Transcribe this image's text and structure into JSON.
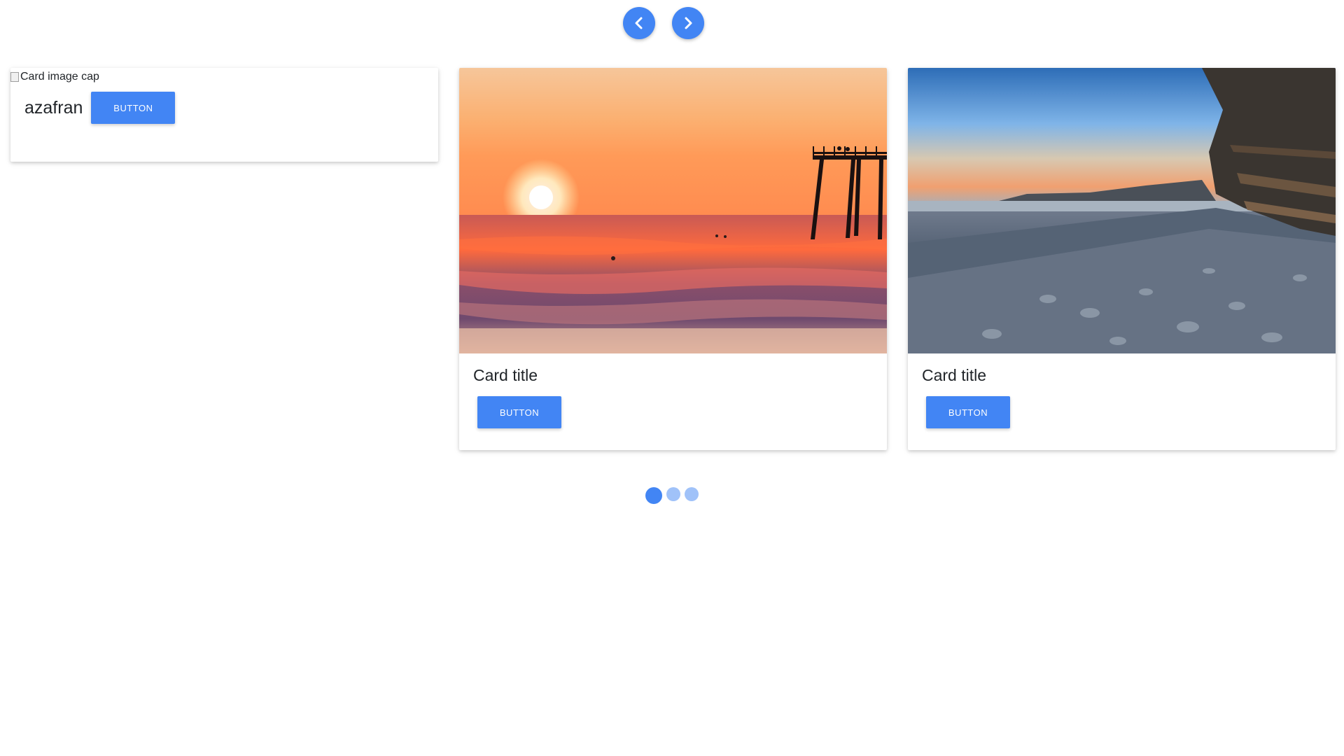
{
  "controls": {
    "prev_icon": "chevron-left-icon",
    "next_icon": "chevron-right-icon"
  },
  "cards": [
    {
      "image_alt": "Card image cap",
      "title": "azafran",
      "button_label": "Button"
    },
    {
      "title": "Card title",
      "button_label": "Button",
      "image": "sunset over ocean with pier"
    },
    {
      "title": "Card title",
      "button_label": "Button",
      "image": "rocky beach with cliffs at dusk"
    }
  ],
  "indicators": {
    "count": 3,
    "active_index": 0
  },
  "colors": {
    "primary": "#4285f4"
  }
}
